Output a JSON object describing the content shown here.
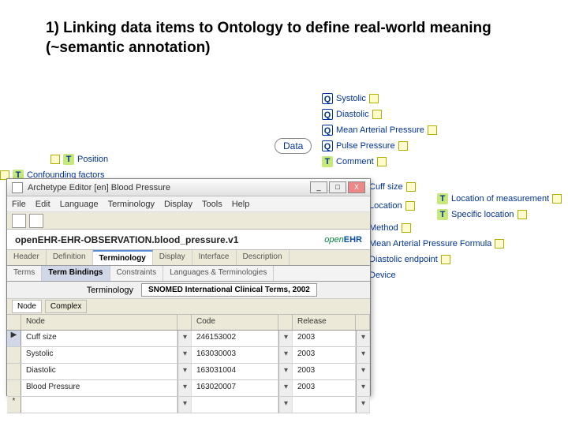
{
  "heading": "1)  Linking data items to Ontology to define real-world meaning (~semantic annotation)",
  "mindmap": {
    "center": "Data",
    "left": [
      {
        "icon": "T",
        "label": "Position"
      },
      {
        "icon": "T",
        "label": "Confounding factors"
      }
    ],
    "right": [
      {
        "icon": "Q",
        "label": "Systolic"
      },
      {
        "icon": "Q",
        "label": "Diastolic"
      },
      {
        "icon": "Q",
        "label": "Mean Arterial Pressure"
      },
      {
        "icon": "Q",
        "label": "Pulse Pressure"
      },
      {
        "icon": "T",
        "label": "Comment"
      },
      {
        "icon": "",
        "label": "Cuff size"
      },
      {
        "icon": "",
        "label": "Location"
      },
      {
        "icon": "",
        "label": "Method"
      },
      {
        "icon": "",
        "label": "Mean Arterial Pressure Formula"
      },
      {
        "icon": "",
        "label": "Diastolic endpoint"
      },
      {
        "icon": "",
        "label": "Device"
      }
    ],
    "locsub": [
      {
        "icon": "T",
        "label": "Location of measurement"
      },
      {
        "icon": "T",
        "label": "Specific location"
      }
    ]
  },
  "editor": {
    "title": "Archetype Editor [en] Blood Pressure",
    "menus": [
      "File",
      "Edit",
      "Language",
      "Terminology",
      "Display",
      "Tools",
      "Help"
    ],
    "id": "openEHR-EHR-OBSERVATION.blood_pressure.v1",
    "logo_a": "open",
    "logo_b": "EHR",
    "tabsA": [
      "Header",
      "Definition",
      "Terminology",
      "Display",
      "Interface",
      "Description"
    ],
    "tabsA_active": 2,
    "tabsB": [
      "Terms",
      "Term Bindings",
      "Constraints",
      "Languages & Terminologies"
    ],
    "tabsB_active": 1,
    "terminology_label": "Terminology",
    "terminology_value": "SNOMED International Clinical Terms, 2002",
    "nodetabs": [
      "Node",
      "Complex"
    ],
    "nodetabs_active": 0,
    "grid_headers": [
      "Node",
      "Code",
      "Release"
    ],
    "grid_rows": [
      {
        "node": "Cuff size",
        "code": "246153002",
        "release": "2003",
        "sel": true
      },
      {
        "node": "Systolic",
        "code": "163030003",
        "release": "2003"
      },
      {
        "node": "Diastolic",
        "code": "163031004",
        "release": "2003"
      },
      {
        "node": "Blood Pressure",
        "code": "163020007",
        "release": "2003"
      },
      {
        "node": "",
        "code": "",
        "release": "",
        "star": true
      }
    ],
    "winbtns": {
      "min": "_",
      "max": "□",
      "close": "X"
    }
  }
}
